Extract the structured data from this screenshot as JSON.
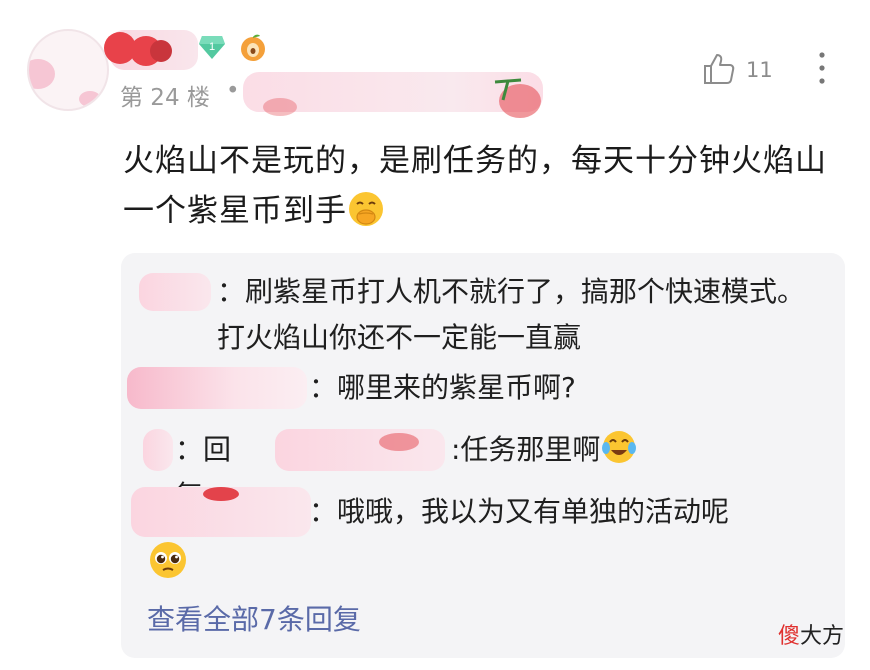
{
  "comment": {
    "floor": "第 24 楼",
    "separator": "•",
    "like_count": "11",
    "text": "火焰山不是玩的，是刷任务的，每天十分钟火焰山一个紫星币到手",
    "level_badge": "1",
    "icons": {
      "like": "thumbs-up-icon",
      "more": "more-vertical-icon",
      "emoji": "covering-mouth-emoji-icon"
    }
  },
  "replies": [
    {
      "prefix": "：",
      "text": "刷紫星币打人机不就行了，搞那个快速模式。打火焰山你还不一定能一直赢"
    },
    {
      "prefix": "：",
      "text": "哪里来的紫星币啊?"
    },
    {
      "prefix": "：",
      "reply_word": "回复",
      "text": ":任务那里啊"
    },
    {
      "prefix": "：",
      "text": "哦哦，我以为又有单独的活动呢"
    }
  ],
  "view_all": "查看全部7条回复",
  "watermark": {
    "part1": "傻",
    "part2": "大方"
  },
  "colors": {
    "link": "#5a6aa8",
    "meta": "#9a9a9a",
    "reply_bg": "#f4f4f6"
  }
}
